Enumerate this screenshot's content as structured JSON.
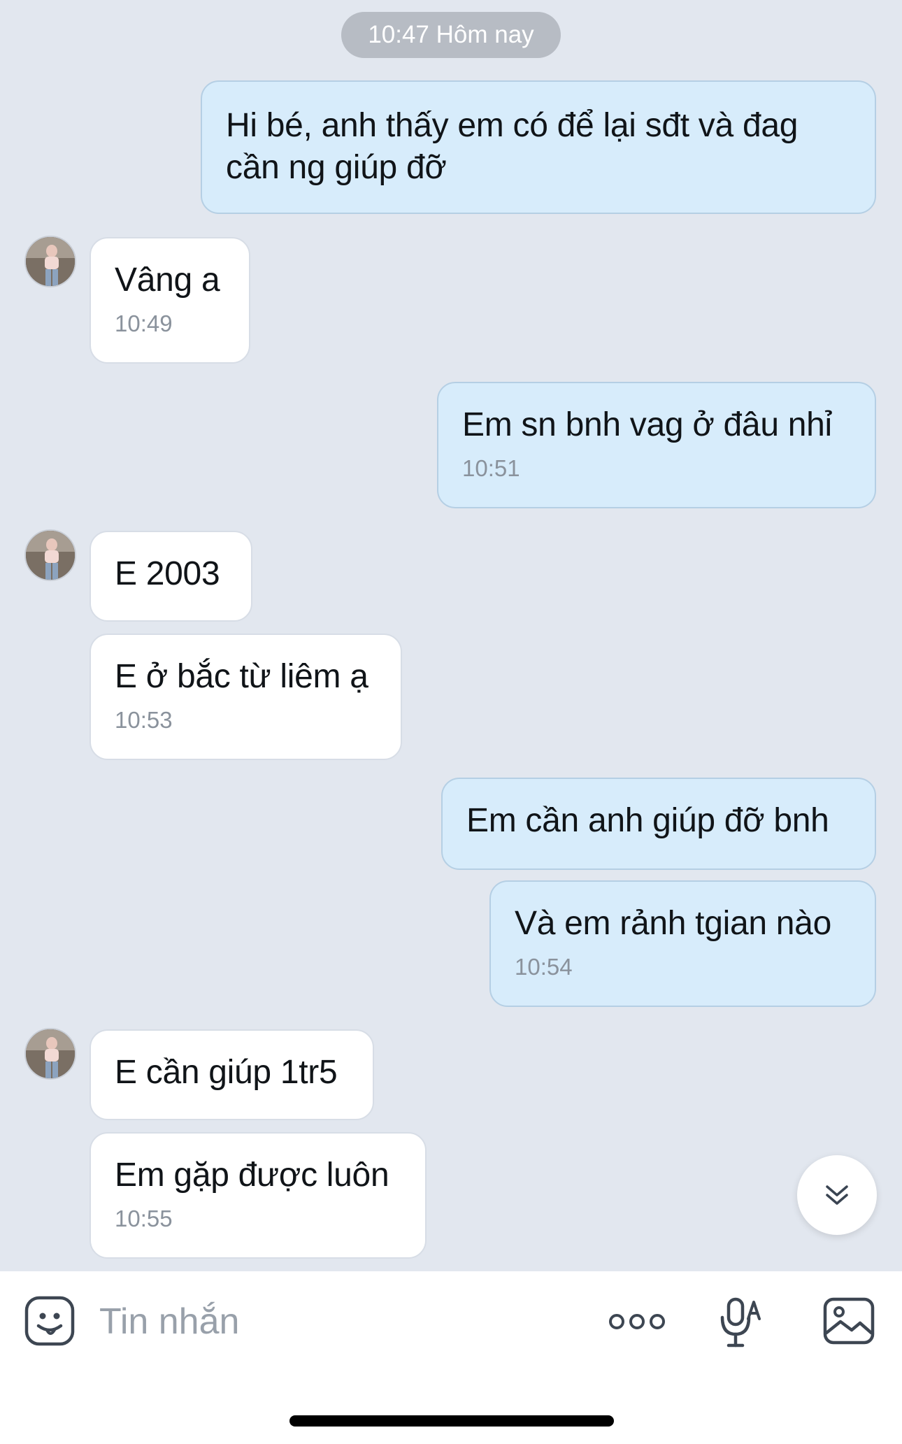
{
  "day_separator": "10:47 Hôm nay",
  "messages": [
    {
      "text": "Hi bé, anh thấy em có để lại sđt và đag cần ng giúp đỡ",
      "time": ""
    },
    {
      "text": "Vâng a",
      "time": "10:49"
    },
    {
      "text": "Em sn bnh vag ở đâu nhỉ",
      "time": "10:51"
    },
    {
      "text": "E 2003",
      "time": ""
    },
    {
      "text": "E ở bắc từ liêm ạ",
      "time": "10:53"
    },
    {
      "text": "Em cần anh giúp đỡ bnh",
      "time": ""
    },
    {
      "text": "Và em rảnh tgian nào",
      "time": "10:54"
    },
    {
      "text": "E cần giúp 1tr5",
      "time": ""
    },
    {
      "text": "Em gặp được luôn",
      "time": "10:55"
    }
  ],
  "composer": {
    "placeholder": "Tin nhắn",
    "icons": [
      "sticker-icon",
      "more-icon",
      "voice-to-text-icon",
      "image-icon"
    ]
  },
  "scroll_button_icon": "double-chevron-down-icon",
  "colors": {
    "background": "#e2e7ef",
    "outgoing_bubble": "#d7ecfb",
    "incoming_bubble": "#ffffff",
    "timestamp": "#8a929c"
  }
}
